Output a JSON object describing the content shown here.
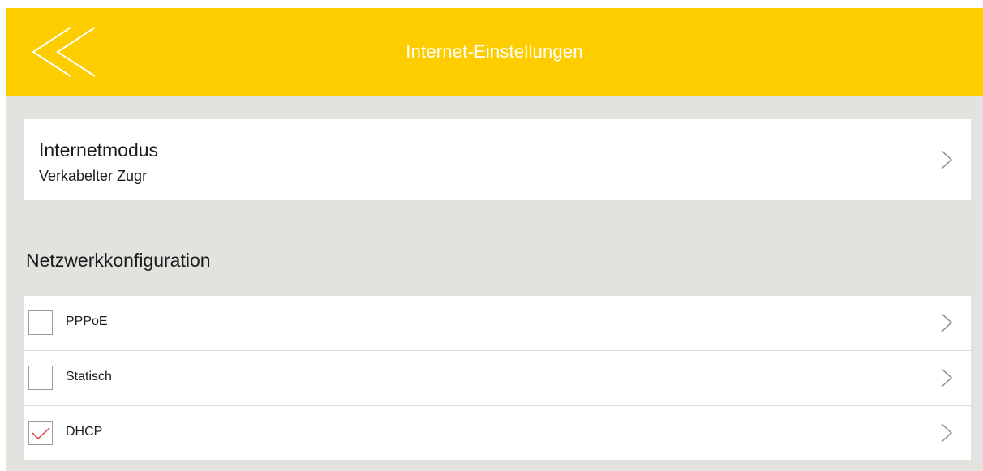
{
  "header": {
    "title": "Internet-Einstellungen",
    "back_icon": "double-chevron-left-icon"
  },
  "internet_mode": {
    "title": "Internetmodus",
    "value": "Verkabelter Zugr",
    "chevron_icon": "chevron-right-icon"
  },
  "network_config": {
    "title": "Netzwerkkonfiguration",
    "items": [
      {
        "label": "PPPoE",
        "checked": false
      },
      {
        "label": "Statisch",
        "checked": false
      },
      {
        "label": "DHCP",
        "checked": true
      }
    ]
  },
  "colors": {
    "header_background": "#fdcd00",
    "page_background": "#e4e2df",
    "card_background": "#ffffff",
    "check_mark": "#e0393b"
  }
}
